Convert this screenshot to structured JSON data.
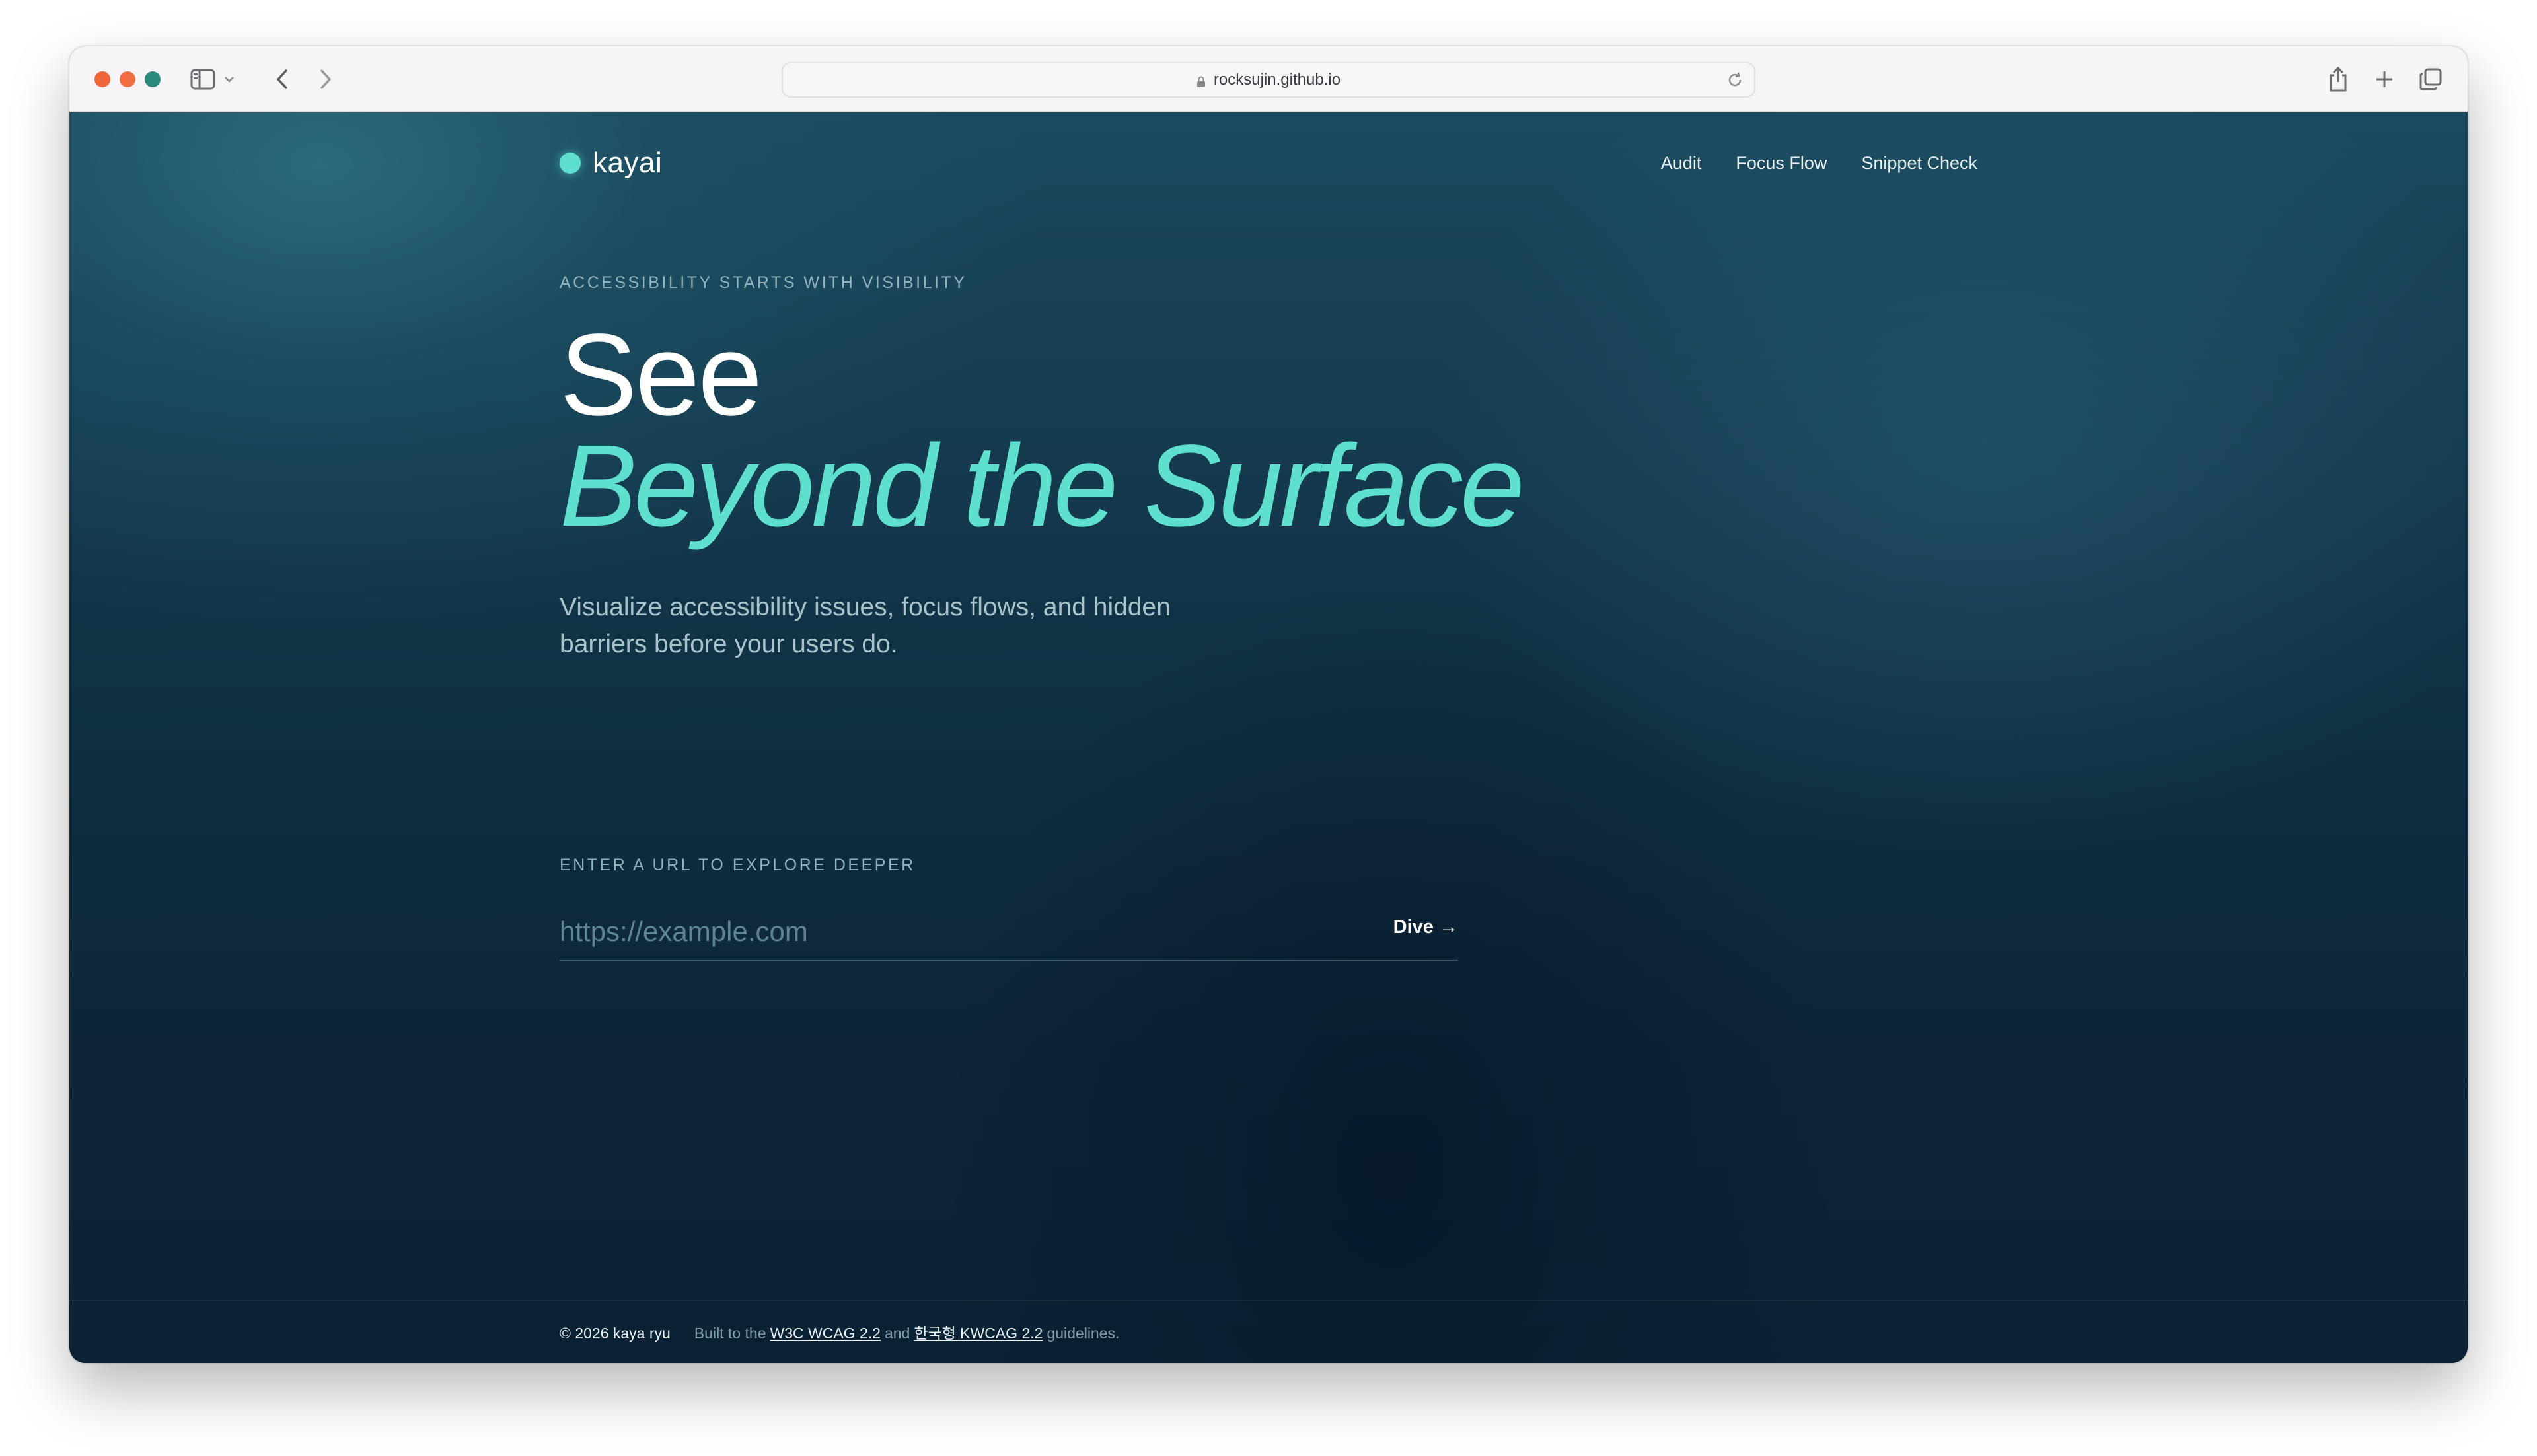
{
  "browser": {
    "url": "rocksujin.github.io",
    "icons": {
      "sidebar": "sidebar-icon",
      "back": "chevron-left-icon",
      "forward": "chevron-right-icon",
      "share": "share-icon",
      "new_tab": "plus-icon",
      "tabs": "tabs-overview-icon",
      "reload": "reload-icon",
      "lock": "lock-icon"
    }
  },
  "header": {
    "logo": "kayai",
    "nav": [
      "Audit",
      "Focus Flow",
      "Snippet Check"
    ]
  },
  "hero": {
    "eyebrow": "ACCESSIBILITY STARTS WITH VISIBILITY",
    "headline_line1": "See",
    "headline_line2": "Beyond the Surface",
    "subtitle": "Visualize accessibility issues, focus flows, and hidden barriers before your users do."
  },
  "url_form": {
    "label": "ENTER A URL TO EXPLORE DEEPER",
    "placeholder": "https://example.com",
    "value": "",
    "button_label": "Dive →"
  },
  "footer": {
    "copyright": "© 2026 kaya ryu",
    "text_before": "Built to the",
    "link1": "W3C WCAG 2.2",
    "text_middle": "and",
    "link2": "한국형 KWCAG 2.2",
    "text_after": "guidelines."
  },
  "colors": {
    "accent": "#5fe0cf",
    "background_dark": "#0c2538",
    "background_light": "#1b4a5e",
    "traffic_red": "#f0663a",
    "traffic_green": "#2a8a7c"
  }
}
